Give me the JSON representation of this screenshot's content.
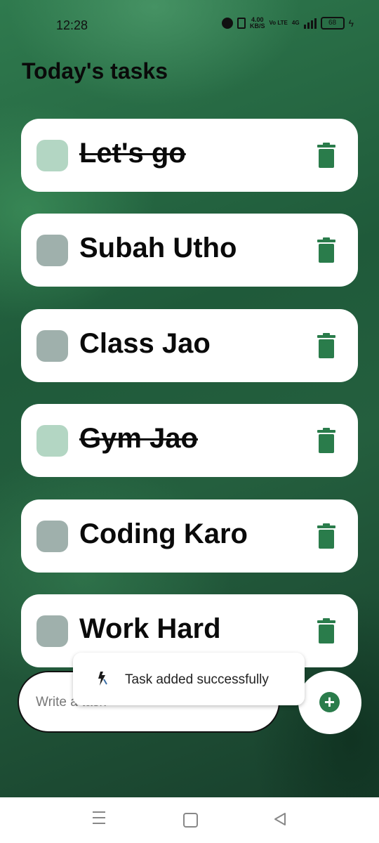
{
  "status_bar": {
    "time": "12:28",
    "net_speed_value": "4.00",
    "net_speed_unit": "KB/S",
    "volte": "Vo LTE",
    "network": "4G",
    "battery": "68"
  },
  "header": {
    "title": "Today's tasks"
  },
  "tasks": [
    {
      "label": "Let's go",
      "done": true
    },
    {
      "label": "Subah Utho",
      "done": false
    },
    {
      "label": "Class Jao",
      "done": false
    },
    {
      "label": "Gym Jao",
      "done": true
    },
    {
      "label": "Coding Karo",
      "done": false
    },
    {
      "label": "Work Hard",
      "done": false
    }
  ],
  "composer": {
    "placeholder": "Write a task",
    "value": ""
  },
  "toast": {
    "text": "Task added successfully"
  },
  "icons": {
    "trash": "trash-icon",
    "add": "plus-circle-icon",
    "toast": "app-icon"
  },
  "colors": {
    "accent": "#2a7c4b",
    "checkbox_done": "#b3d6c3",
    "checkbox_pending": "#9fb0ac"
  }
}
